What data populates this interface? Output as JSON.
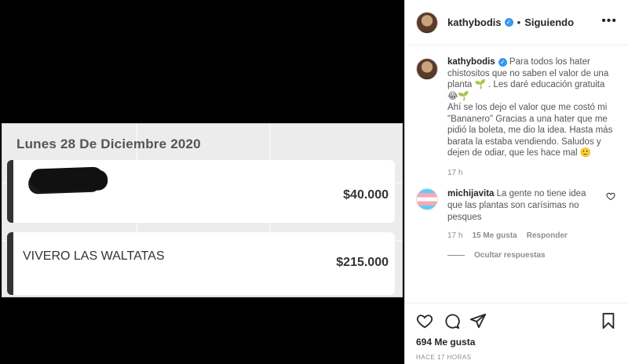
{
  "media": {
    "receipt_date": "Lunes 28 De Diciembre 2020",
    "entries": [
      {
        "name": "",
        "amount": "$40.000"
      },
      {
        "name": "VIVERO LAS WALTATAS",
        "amount": "$215.000"
      }
    ]
  },
  "header": {
    "username": "kathybodis",
    "separator": "•",
    "follow_label": "Siguiendo",
    "more": "•••"
  },
  "caption": {
    "username": "kathybodis",
    "text": "Para todos los hater chistositos que no saben el valor de una planta 🌱 . Les daré educación gratuita 😂🌱\nAhí se los dejo el valor que me costó mi \"Bananero\" Gracias a una hater que me pidió la boleta, me dio la idea. Hasta más barata la estaba vendiendo. Saludos y dejen de odiar, que les hace mal 🙂",
    "time": "17 h"
  },
  "comment": {
    "username": "michijavita",
    "text": "La gente no tiene idea que las plantas son carísimas no pesques",
    "time": "17 h",
    "likes": "15 Me gusta",
    "reply": "Responder",
    "hide_replies": "Ocultar respuestas"
  },
  "footer": {
    "likes": "694 Me gusta",
    "ago": "HACE 17 HORAS"
  },
  "colors": {
    "verified": "#3897f0",
    "text": "#262626",
    "muted": "#8e8e8e"
  }
}
